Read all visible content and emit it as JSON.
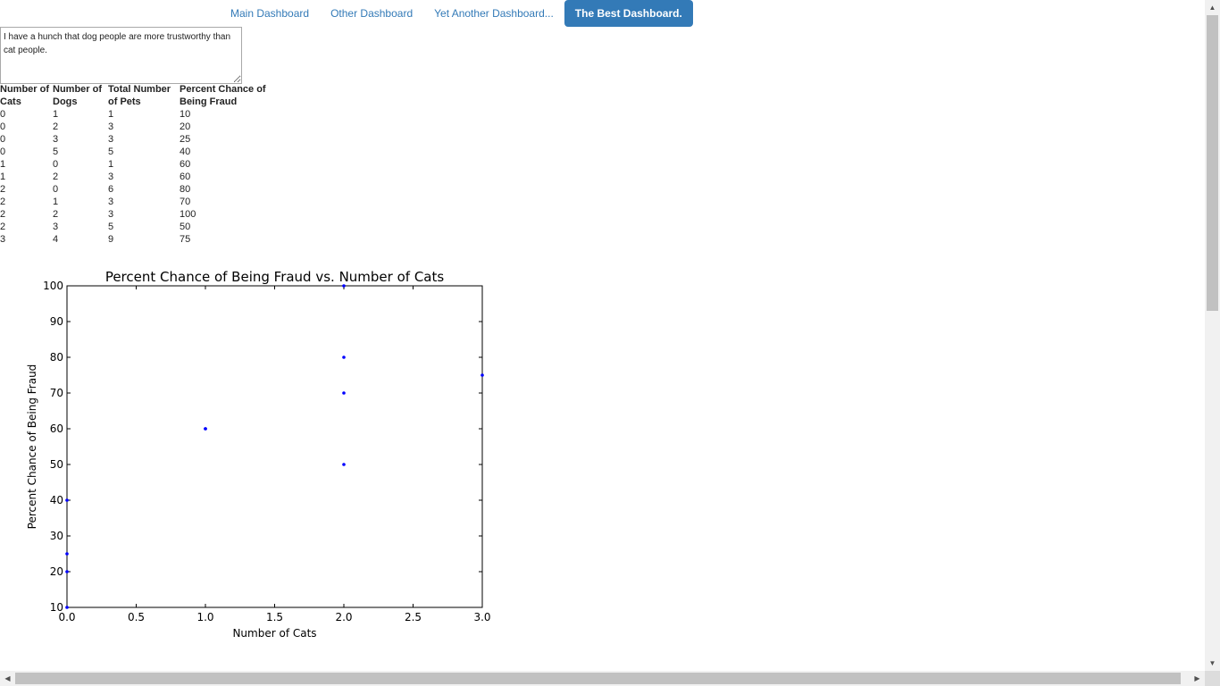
{
  "nav": {
    "tabs": [
      {
        "label": "Main Dashboard",
        "active": false
      },
      {
        "label": "Other Dashboard",
        "active": false
      },
      {
        "label": "Yet Another Dashboard...",
        "active": false
      },
      {
        "label": "The Best Dashboard.",
        "active": true
      }
    ],
    "accent_color": "#337ab7"
  },
  "note": {
    "value": "I have a hunch that dog people are more trustworthy than cat people."
  },
  "table": {
    "headers": [
      "Number of Cats",
      "Number of Dogs",
      "Total Number of Pets",
      "Percent Chance of Being Fraud"
    ],
    "rows": [
      [
        "0",
        "1",
        "1",
        "10"
      ],
      [
        "0",
        "2",
        "3",
        "20"
      ],
      [
        "0",
        "3",
        "3",
        "25"
      ],
      [
        "0",
        "5",
        "5",
        "40"
      ],
      [
        "1",
        "0",
        "1",
        "60"
      ],
      [
        "1",
        "2",
        "3",
        "60"
      ],
      [
        "2",
        "0",
        "6",
        "80"
      ],
      [
        "2",
        "1",
        "3",
        "70"
      ],
      [
        "2",
        "2",
        "3",
        "100"
      ],
      [
        "2",
        "3",
        "5",
        "50"
      ],
      [
        "3",
        "4",
        "9",
        "75"
      ]
    ]
  },
  "chart_data": {
    "type": "scatter",
    "title": "Percent Chance of Being Fraud vs. Number of Cats",
    "xlabel": "Number of Cats",
    "ylabel": "Percent Chance of Being Fraud",
    "xlim": [
      0.0,
      3.0
    ],
    "ylim": [
      10,
      100
    ],
    "xticks": [
      "0.0",
      "0.5",
      "1.0",
      "1.5",
      "2.0",
      "2.5",
      "3.0"
    ],
    "yticks": [
      "10",
      "20",
      "30",
      "40",
      "50",
      "60",
      "70",
      "80",
      "90",
      "100"
    ],
    "x": [
      0,
      0,
      0,
      0,
      1,
      1,
      2,
      2,
      2,
      2,
      3
    ],
    "y": [
      10,
      20,
      25,
      40,
      60,
      60,
      80,
      70,
      100,
      50,
      75
    ],
    "point_color": "#0000ff",
    "grid": false
  },
  "scrollbars": {
    "up_arrow": "▲",
    "down_arrow": "▼",
    "left_arrow": "◀",
    "right_arrow": "▶"
  }
}
